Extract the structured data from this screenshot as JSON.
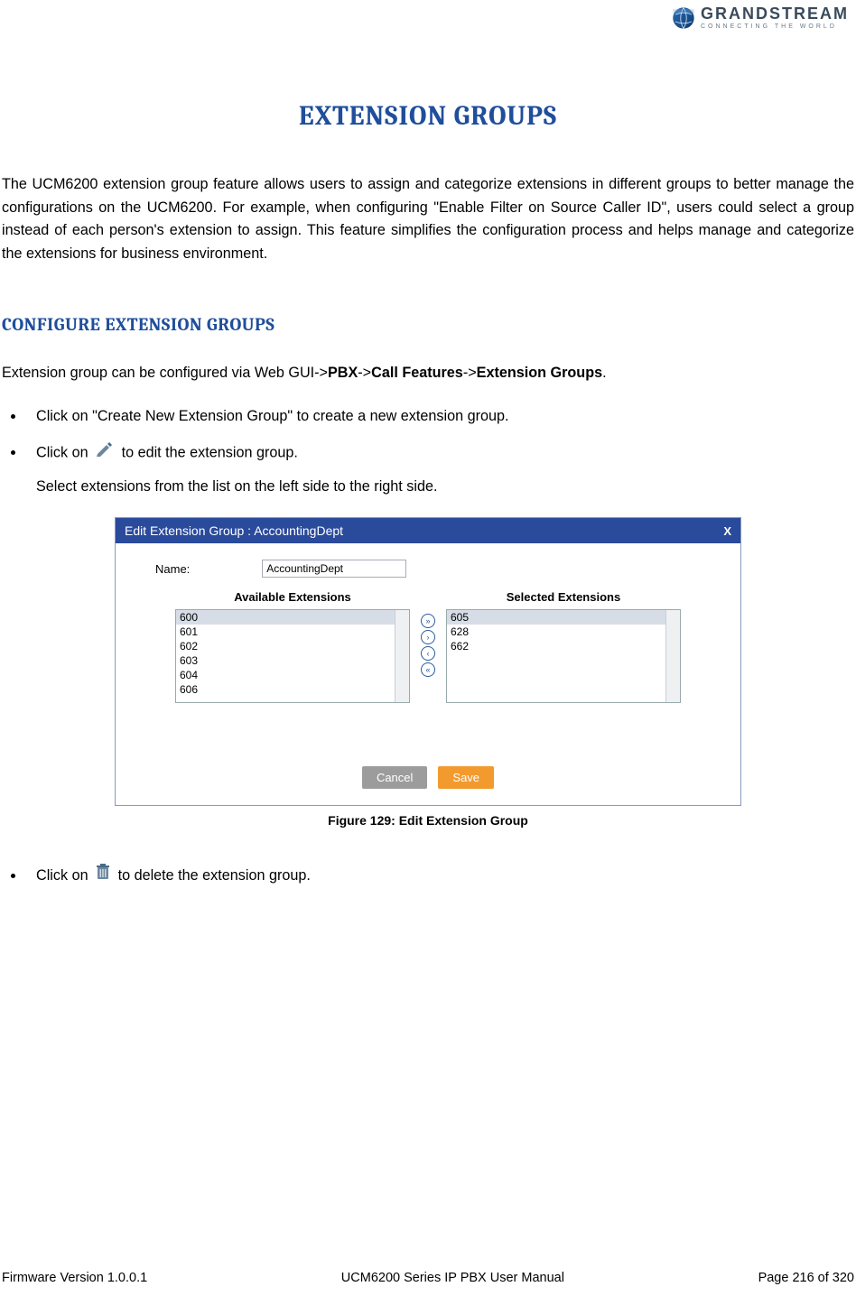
{
  "logo": {
    "brand": "GRANDSTREAM",
    "tagline": "CONNECTING THE WORLD"
  },
  "title": "EXTENSION GROUPS",
  "intro": "The UCM6200 extension group feature allows users to assign and categorize extensions in different groups to better manage the configurations on the UCM6200. For example, when configuring \"Enable Filter on Source Caller ID\", users could select a group instead of each person's extension to assign. This feature simplifies the configuration process and helps manage and categorize the extensions for business environment.",
  "section": {
    "heading": "CONFIGURE EXTENSION GROUPS",
    "nav_line_pre": "Extension group can be configured via Web GUI->",
    "nav_path": [
      "PBX",
      "Call Features",
      "Extension Groups"
    ],
    "sep": "->",
    "period": "."
  },
  "bullets": {
    "b1": "Click on \"Create New Extension Group\" to create a new extension group.",
    "b2_pre": "Click on ",
    "b2_post": " to edit the extension group.",
    "b2_sub": "Select extensions from the list on the left side to the right side.",
    "b3_pre": "Click on ",
    "b3_post": " to delete the extension group."
  },
  "dialog": {
    "title": "Edit Extension Group : AccountingDept",
    "close": "X",
    "name_label": "Name:",
    "name_value": "AccountingDept",
    "avail_head": "Available Extensions",
    "sel_head": "Selected Extensions",
    "available": [
      "600",
      "601",
      "602",
      "603",
      "604",
      "606"
    ],
    "selected": [
      "605",
      "628",
      "662"
    ],
    "cancel": "Cancel",
    "save": "Save"
  },
  "figure_caption": "Figure 129: Edit Extension Group",
  "footer": {
    "left": "Firmware Version 1.0.0.1",
    "center": "UCM6200 Series IP PBX User Manual",
    "right": "Page 216 of 320"
  }
}
